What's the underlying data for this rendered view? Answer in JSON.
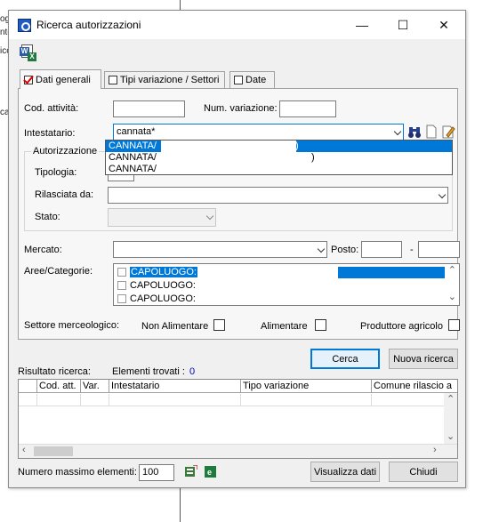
{
  "background": {
    "fragments": [
      "ogi",
      "nto",
      "icc",
      "cas"
    ]
  },
  "window": {
    "title": "Ricerca autorizzazioni",
    "minimize": "—",
    "maximize": "☐",
    "close": "✕"
  },
  "tabs": [
    {
      "label": "Dati generali",
      "active": true
    },
    {
      "label": "Tipi variazione / Settori",
      "active": false
    },
    {
      "label": "Date",
      "active": false
    }
  ],
  "form": {
    "cod_attivita_label": "Cod. attività:",
    "cod_attivita_value": "",
    "num_variazione_label": "Num. variazione:",
    "num_variazione_value": "",
    "intestatario_label": "Intestatario:",
    "intestatario_value": "cannata*",
    "autorizzazione_group": "Autorizzazione",
    "tipologia_label": "Tipologia:",
    "rilasciata_label": "Rilasciata da:",
    "stato_label": "Stato:",
    "mercato_label": "Mercato:",
    "posto_label": "Posto:",
    "posto_sep": "-",
    "aree_label": "Aree/Categorie:",
    "aree_items": [
      "CAPOLUOGO:",
      "CAPOLUOGO:",
      "CAPOLUOGO:"
    ],
    "settore_label": "Settore merceologico:",
    "non_alimentare_label": "Non Alimentare",
    "alimentare_label": "Alimentare",
    "produttore_label": "Produttore agricolo"
  },
  "dropdown": {
    "items": [
      {
        "text": "CANNATA/",
        "suffix": ")",
        "selected": true
      },
      {
        "text": "CANNATA/",
        "suffix": ")",
        "selected": false
      },
      {
        "text": "CANNATA/",
        "suffix": "",
        "selected": false
      }
    ]
  },
  "actions": {
    "cerca": "Cerca",
    "nuova_ricerca": "Nuova ricerca"
  },
  "results": {
    "label": "Risultato ricerca:",
    "found_label": "Elementi trovati :",
    "found_count": "0",
    "columns": [
      "Cod. att.",
      "Var.",
      "Intestatario",
      "Tipo variazione",
      "Comune rilascio a"
    ]
  },
  "footer": {
    "max_label": "Numero massimo elementi:",
    "max_value": "100",
    "visualizza": "Visualizza dati",
    "chiudi": "Chiudi"
  },
  "icons": {
    "app": "app-search-icon",
    "word_excel": "word-excel-export-icon",
    "binoculars": "binoculars-icon",
    "new_doc": "new-document-icon",
    "edit": "edit-document-icon",
    "export_a": "export-icon",
    "export_b": "excel-export-icon"
  },
  "colors": {
    "accent": "#0078d7",
    "count": "#0000c0"
  }
}
